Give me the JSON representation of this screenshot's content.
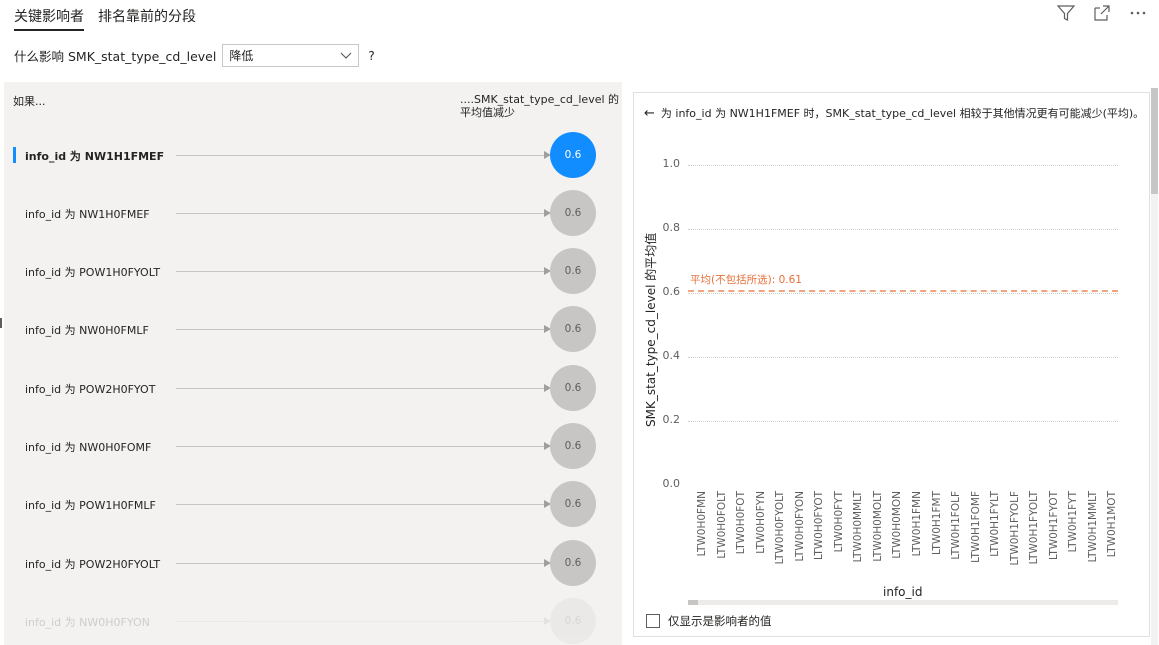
{
  "tabs": [
    {
      "label": "关键影响者"
    },
    {
      "label": "排名靠前的分段"
    }
  ],
  "question": {
    "prefix": "什么影响 SMK_stat_type_cd_level",
    "selected": "降低",
    "help": "?"
  },
  "left_panel": {
    "if_header": "如果...",
    "result_header": "....SMK_stat_type_cd_level 的平均值减少",
    "rows": [
      {
        "label": "info_id 为 NW1H1FMEF",
        "value": "0.6",
        "selected": true
      },
      {
        "label": "info_id 为 NW1H0FMEF",
        "value": "0.6"
      },
      {
        "label": "info_id 为 POW1H0FYOLT",
        "value": "0.6"
      },
      {
        "label": "info_id 为 NW0H0FMLF",
        "value": "0.6"
      },
      {
        "label": "info_id 为 POW2H0FYOT",
        "value": "0.6"
      },
      {
        "label": "info_id 为 NW0H0FOMF",
        "value": "0.6"
      },
      {
        "label": "info_id 为 POW1H0FMLF",
        "value": "0.6"
      },
      {
        "label": "info_id 为 POW2H0FYOLT",
        "value": "0.6"
      },
      {
        "label": "info_id 为 NW0H0FYON",
        "value": "0.6"
      }
    ]
  },
  "right_panel": {
    "header": "为 info_id 为 NW1H1FMEF 时，SMK_stat_type_cd_level 相较于其他情况更有可能减少(平均)。",
    "checkbox_label": "仅显示是影响者的值"
  },
  "chart_data": {
    "type": "bar",
    "xlabel": "info_id",
    "ylabel": "SMK_stat_type_cd_level 的平均值",
    "ylim": [
      0.0,
      1.0
    ],
    "yticks": [
      "0.0",
      "0.2",
      "0.4",
      "0.6",
      "0.8",
      "1.0"
    ],
    "grid": true,
    "categories": [
      "LTW0H0FMN",
      "LTW0H0FOLT",
      "LTW0H0FOT",
      "LTW0H0FYN",
      "LTW0H0FYOLT",
      "LTW0H0FYON",
      "LTW0H0FYOT",
      "LTW0H0FYT",
      "LTW0H0MMLT",
      "LTW0H0MOLT",
      "LTW0H0MON",
      "LTW0H1FMN",
      "LTW0H1FMT",
      "LTW0H1FOLF",
      "LTW0H1FOMF",
      "LTW0H1FYLT",
      "LTW0H1FYOLF",
      "LTW0H1FYOLT",
      "LTW0H1FYOT",
      "LTW0H1FYT",
      "LTW0H1MMLT",
      "LTW0H1MOT"
    ],
    "average_line": {
      "label": "平均(不包括所选): 0.61",
      "value": 0.61,
      "color": "#f0a47f"
    }
  }
}
